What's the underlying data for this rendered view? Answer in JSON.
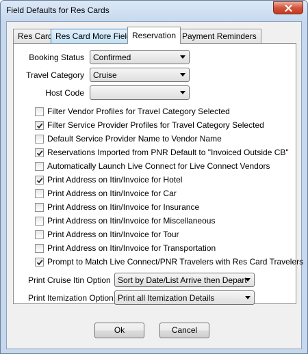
{
  "window": {
    "title": "Field Defaults for Res Cards"
  },
  "tabs": [
    {
      "label": "Res Card"
    },
    {
      "label": "Res Card More Fields"
    },
    {
      "label": "Reservation"
    },
    {
      "label": "Payment Reminders"
    }
  ],
  "reservation": {
    "booking_status": {
      "label": "Booking Status",
      "value": "Confirmed"
    },
    "travel_category": {
      "label": "Travel Category",
      "value": "Cruise"
    },
    "host_code": {
      "label": "Host Code",
      "value": ""
    },
    "checkboxes": [
      {
        "label": "Filter Vendor Profiles for Travel Category Selected",
        "checked": false
      },
      {
        "label": "Filter Service Provider Profiles for Travel Category Selected",
        "checked": true
      },
      {
        "label": "Default Service Provider Name to Vendor Name",
        "checked": false
      },
      {
        "label": "Reservations Imported from PNR Default to \"Invoiced Outside CB\"",
        "checked": true
      },
      {
        "label": "Automatically Launch Live Connect for Live Connect Vendors",
        "checked": false
      },
      {
        "label": "Print Address on Itin/Invoice for Hotel",
        "checked": true
      },
      {
        "label": "Print Address on Itin/Invoice for Car",
        "checked": false
      },
      {
        "label": "Print Address on Itin/Invoice for Insurance",
        "checked": false
      },
      {
        "label": "Print Address on Itin/Invoice for Miscellaneous",
        "checked": false
      },
      {
        "label": "Print Address on Itin/Invoice for Tour",
        "checked": false
      },
      {
        "label": "Print Address on Itin/Invoice for Transportation",
        "checked": false
      },
      {
        "label": "Prompt to Match Live Connect/PNR Travelers with Res Card Travelers",
        "checked": true
      }
    ],
    "print_cruise_itin": {
      "label": "Print Cruise Itin Option",
      "value": "Sort by Date/List Arrive then Depart"
    },
    "print_itemization": {
      "label": "Print Itemization Option",
      "value": "Print all Itemization Details"
    }
  },
  "buttons": {
    "ok": "Ok",
    "cancel": "Cancel"
  }
}
